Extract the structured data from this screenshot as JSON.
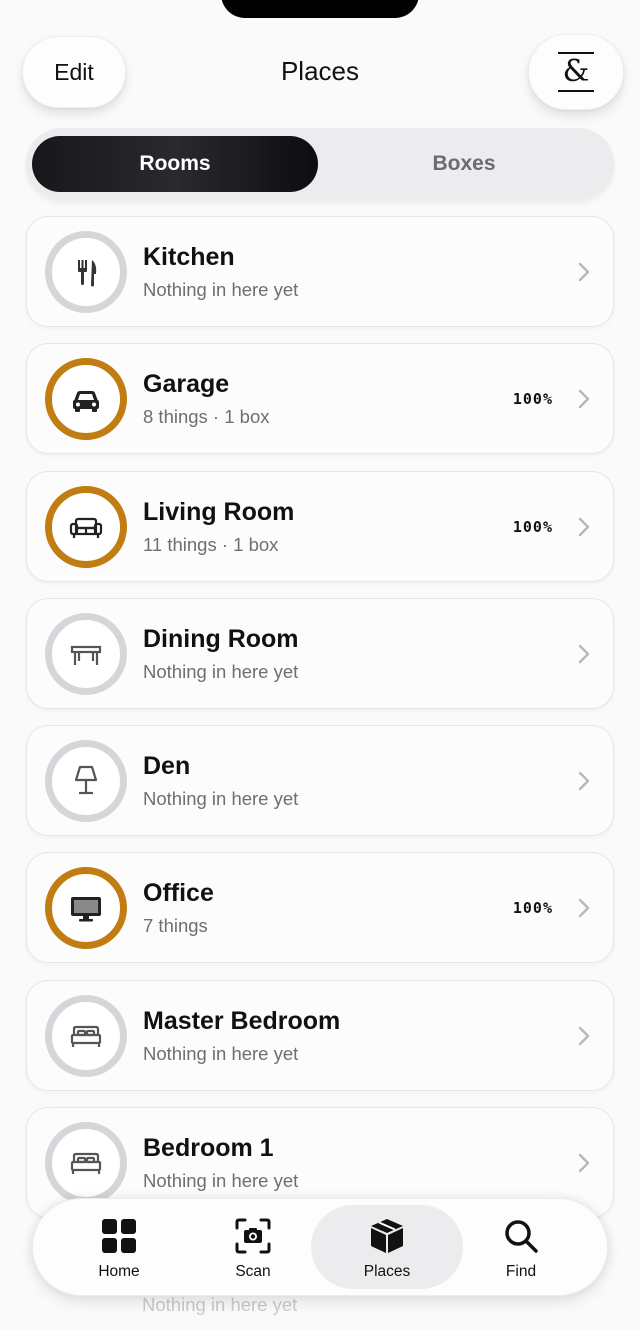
{
  "header": {
    "edit_label": "Edit",
    "title": "Places",
    "logo_glyph": "&"
  },
  "segmented": {
    "options": [
      "Rooms",
      "Boxes"
    ],
    "selected": "Rooms"
  },
  "rooms": [
    {
      "name": "Kitchen",
      "subtitle": "Nothing in here yet",
      "percent": "",
      "icon": "fork-knife-icon",
      "progress": 0
    },
    {
      "name": "Garage",
      "subtitle": "8 things · 1 box",
      "percent": "100%",
      "icon": "car-icon",
      "progress": 1
    },
    {
      "name": "Living Room",
      "subtitle": "11 things · 1 box",
      "percent": "100%",
      "icon": "sofa-icon",
      "progress": 1
    },
    {
      "name": "Dining Room",
      "subtitle": "Nothing in here yet",
      "percent": "",
      "icon": "table-icon",
      "progress": 0
    },
    {
      "name": "Den",
      "subtitle": "Nothing in here yet",
      "percent": "",
      "icon": "lamp-icon",
      "progress": 0
    },
    {
      "name": "Office",
      "subtitle": "7 things",
      "percent": "100%",
      "icon": "monitor-icon",
      "progress": 1
    },
    {
      "name": "Master Bedroom",
      "subtitle": "Nothing in here yet",
      "percent": "",
      "icon": "bed-icon",
      "progress": 0
    },
    {
      "name": "Bedroom 1",
      "subtitle": "Nothing in here yet",
      "percent": "",
      "icon": "bed-icon",
      "progress": 0
    }
  ],
  "peek_subtitle": "Nothing in here yet",
  "tabbar": {
    "tabs": [
      {
        "label": "Home",
        "icon": "grid-icon"
      },
      {
        "label": "Scan",
        "icon": "camera-scan-icon"
      },
      {
        "label": "Places",
        "icon": "box-icon"
      },
      {
        "label": "Find",
        "icon": "search-icon"
      }
    ],
    "selected": "Places"
  },
  "colors": {
    "accent_ring": "#c17d12",
    "empty_ring": "#d6d6da"
  }
}
